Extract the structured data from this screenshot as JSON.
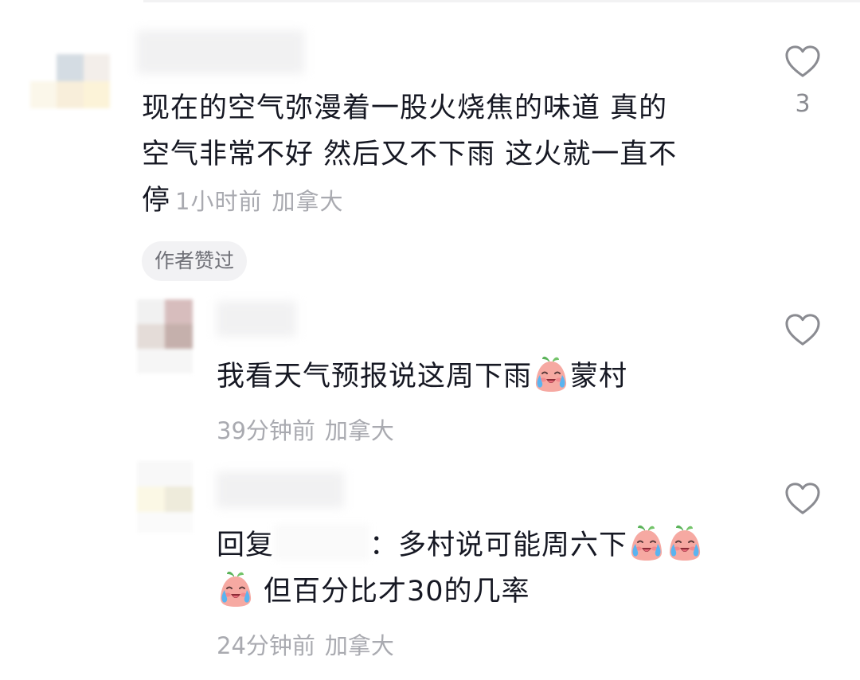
{
  "comment1": {
    "lines": [
      "现在的空气弥漫着一股火烧焦的味道 真的",
      "空气非常不好 然后又不下雨 这火就一直不",
      "停"
    ],
    "time": "1小时前",
    "location": "加拿大",
    "badge": "作者赞过",
    "like_count": "3"
  },
  "reply1": {
    "text": "我看天气预报说这周下雨",
    "text_after": "蒙村",
    "time": "39分钟前",
    "location": "加拿大"
  },
  "reply2": {
    "prefix": "回复",
    "line1": "：多村说可能周六下",
    "line2": "但百分比才30的几率",
    "time": "24分钟前",
    "location": "加拿大"
  },
  "icons": {
    "heart": "heart-outline-icon",
    "emoji": "crying-face-emoji"
  },
  "colors": {
    "text": "#161823",
    "meta": "#a9aab0",
    "heart_stroke": "#8a8b91"
  }
}
